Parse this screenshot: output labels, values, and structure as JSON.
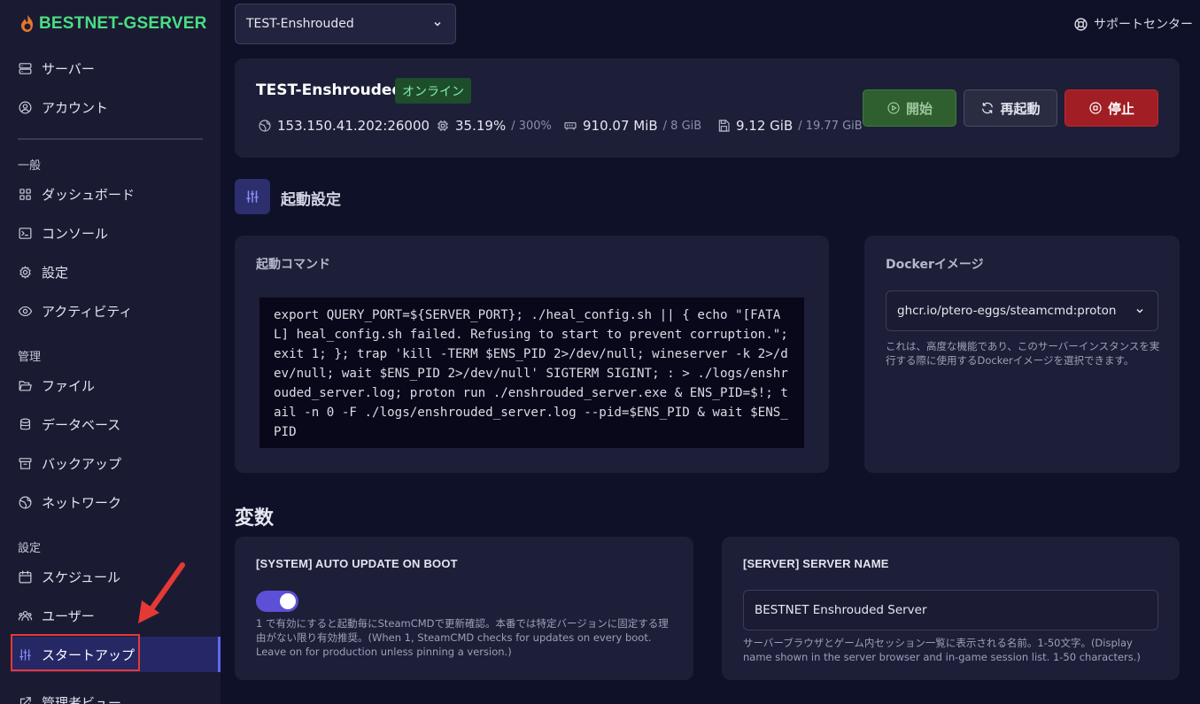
{
  "brand": {
    "name": "BESTNET-GSERVER",
    "color": "#4ade80"
  },
  "sidebar": {
    "top_items": [
      {
        "label": "サーバー",
        "icon": "server-icon"
      },
      {
        "label": "アカウント",
        "icon": "user-circle-icon"
      }
    ],
    "sections": [
      {
        "title": "一般",
        "items": [
          {
            "label": "ダッシュボード",
            "icon": "grid-icon"
          },
          {
            "label": "コンソール",
            "icon": "terminal-icon"
          },
          {
            "label": "設定",
            "icon": "gear-icon"
          },
          {
            "label": "アクティビティ",
            "icon": "eye-icon"
          }
        ]
      },
      {
        "title": "管理",
        "items": [
          {
            "label": "ファイル",
            "icon": "folder-icon"
          },
          {
            "label": "データベース",
            "icon": "database-icon"
          },
          {
            "label": "バックアップ",
            "icon": "archive-icon"
          },
          {
            "label": "ネットワーク",
            "icon": "globe-icon"
          }
        ]
      },
      {
        "title": "設定",
        "items": [
          {
            "label": "スケジュール",
            "icon": "calendar-icon"
          },
          {
            "label": "ユーザー",
            "icon": "users-icon"
          },
          {
            "label": "スタートアップ",
            "icon": "sliders-icon",
            "active": true
          },
          {
            "label": "管理者ビュー",
            "icon": "external-link-icon"
          }
        ]
      }
    ]
  },
  "topbar": {
    "server_select": "TEST-Enshrouded",
    "support": "サポートセンター"
  },
  "server": {
    "name": "TEST-Enshrouded",
    "status": "オンライン",
    "address": "153.150.41.202:26000",
    "cpu": "35.19%",
    "cpu_limit": "/ 300%",
    "memory": "910.07 MiB",
    "memory_limit": "/ 8 GiB",
    "disk": "9.12 GiB",
    "disk_limit": "/ 19.77 GiB",
    "buttons": {
      "start": "開始",
      "restart": "再起動",
      "stop": "停止"
    }
  },
  "startup": {
    "title": "起動設定",
    "command_label": "起動コマンド",
    "command": "export QUERY_PORT=${SERVER_PORT}; ./heal_config.sh || { echo \"[FATAL] heal_config.sh failed. Refusing to start to prevent corruption.\"; exit 1; }; trap 'kill -TERM $ENS_PID 2>/dev/null; wineserver -k 2>/dev/null; wait $ENS_PID 2>/dev/null' SIGTERM SIGINT; : > ./logs/enshrouded_server.log; proton run ./enshrouded_server.exe & ENS_PID=$!; tail -n 0 -F ./logs/enshrouded_server.log --pid=$ENS_PID & wait $ENS_PID",
    "docker_label": "Dockerイメージ",
    "docker_image": "ghcr.io/ptero-eggs/steamcmd:proton",
    "docker_hint": "これは、高度な機能であり、このサーバーインスタンスを実行する際に使用するDockerイメージを選択できます。"
  },
  "variables": {
    "title": "変数",
    "items": [
      {
        "label": "[SYSTEM] AUTO UPDATE ON BOOT",
        "type": "toggle",
        "value": "on",
        "hint": "1 で有効にすると起動毎にSteamCMDで更新確認。本番では特定バージョンに固定する理由がない限り有効推奨。(When 1, SteamCMD checks for updates on every boot. Leave on for production unless pinning a version.)"
      },
      {
        "label": "[SERVER] SERVER NAME",
        "type": "text",
        "value": "BESTNET Enshrouded Server",
        "hint": "サーバーブラウザとゲーム内セッション一覧に表示される名前。1-50文字。(Display name shown in the server browser and in-game session list. 1-50 characters.)"
      }
    ]
  }
}
